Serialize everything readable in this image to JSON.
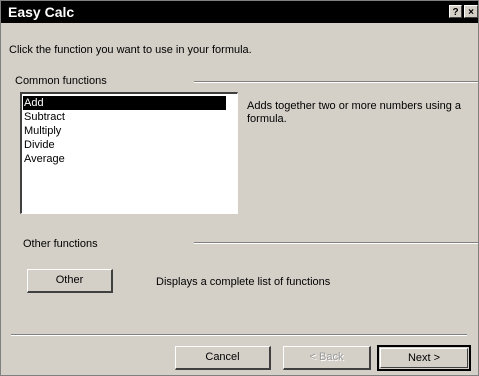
{
  "window": {
    "title": "Easy Calc",
    "help_button": "?",
    "close_button": "×"
  },
  "instruction": "Click the function you want to use in your formula.",
  "common_functions": {
    "label": "Common functions",
    "items": [
      {
        "label": "Add",
        "selected": true
      },
      {
        "label": "Subtract",
        "selected": false
      },
      {
        "label": "Multiply",
        "selected": false
      },
      {
        "label": "Divide",
        "selected": false
      },
      {
        "label": "Average",
        "selected": false
      }
    ],
    "description": "Adds together two or more numbers using a formula."
  },
  "other_functions": {
    "label": "Other functions",
    "button_label": "Other",
    "description": "Displays a complete list of functions"
  },
  "footer": {
    "cancel_label": "Cancel",
    "back_label": "< Back",
    "next_label": "Next >"
  },
  "colors": {
    "dialog_face": "#d4d0c8",
    "titlebar": "#000000",
    "selection": "#000000"
  }
}
